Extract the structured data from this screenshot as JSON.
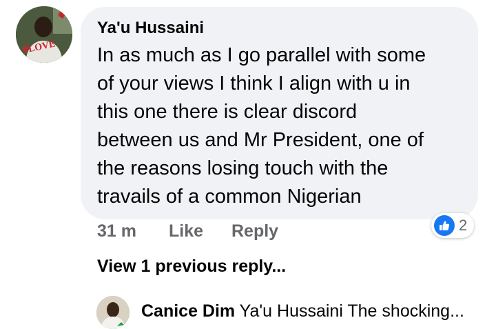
{
  "comment": {
    "author": "Ya'u Hussaini",
    "avatar_badge_text": "LOVE",
    "lines": [
      "In as much as I go parallel with some",
      "of your views I think I align with u in",
      "this one there is clear discord",
      "between us and Mr President, one of",
      "the reasons losing touch with the",
      "travails of a common Nigerian"
    ],
    "time": "31 m",
    "like_label": "Like",
    "reply_label": "Reply",
    "reaction_icon": "like-thumbs-up-icon",
    "reaction_count": "2"
  },
  "view_previous_label": "View 1 previous reply...",
  "reply": {
    "author": "Canice Dim",
    "snippet": "Ya'u Hussaini The shocking..."
  },
  "colors": {
    "bubble": "#f0f2f5",
    "meta_text": "#65676b",
    "like_blue": "#1877f2",
    "text": "#050505"
  }
}
